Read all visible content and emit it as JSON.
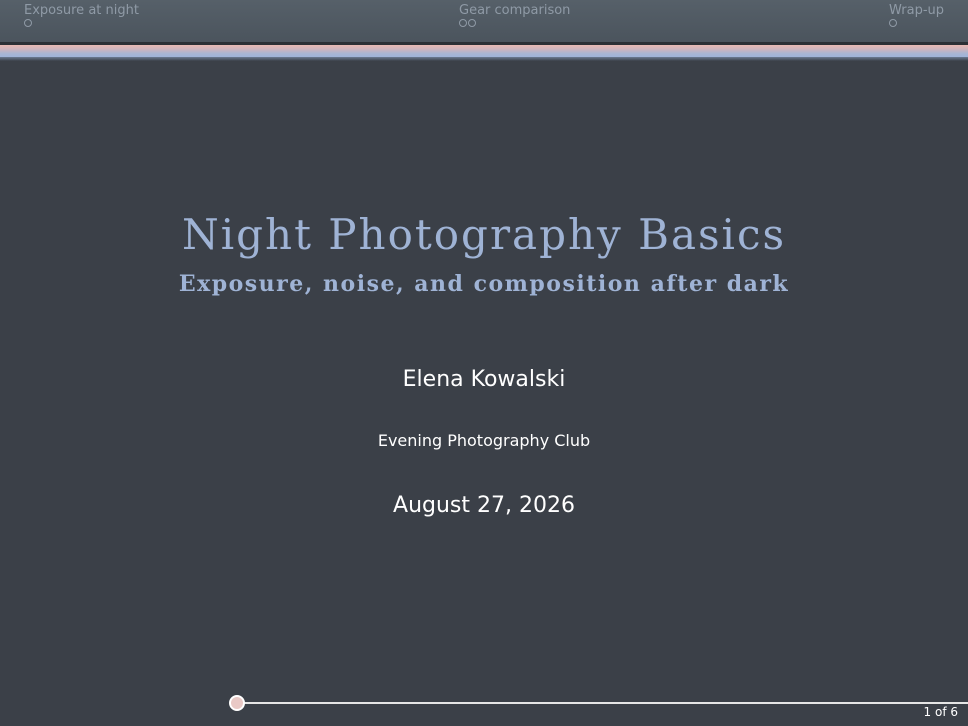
{
  "navbar": {
    "sections": [
      {
        "label": "Exposure at night",
        "frames": 1
      },
      {
        "label": "Gear comparison",
        "frames": 2
      },
      {
        "label": "Wrap-up",
        "frames": 1
      }
    ]
  },
  "slide": {
    "title": "Night Photography Basics",
    "subtitle": "Exposure, noise, and composition after dark",
    "author": "Elena Kowalski",
    "institute": "Evening Photography Club",
    "date": "August 27, 2026"
  },
  "footer": {
    "page_counter": "1 of 6",
    "progress_fraction": 0.0
  },
  "colors": {
    "background": "#3b4048",
    "title": "#9fb3d5",
    "navbar_text": "#8f9aa6",
    "band_top": "#e8b9b3",
    "band_bottom": "#9fb3d9"
  }
}
